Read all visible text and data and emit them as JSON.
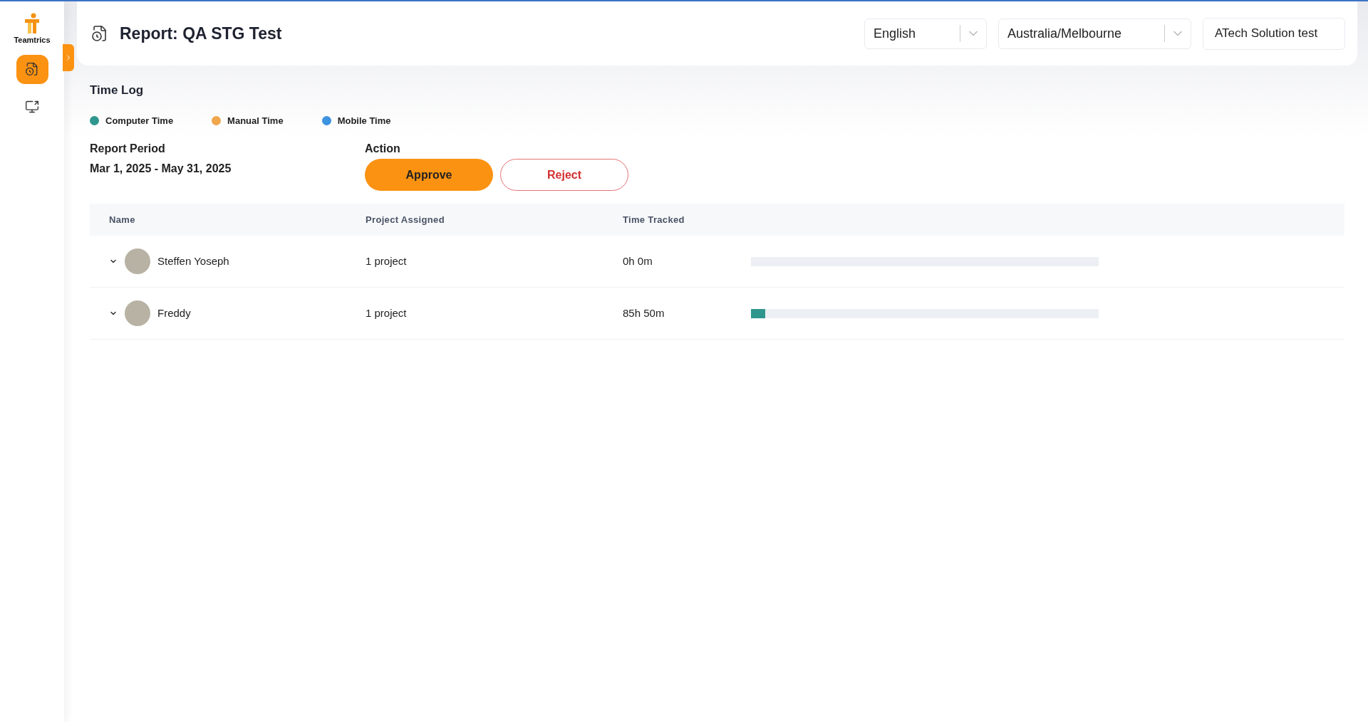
{
  "sidebar": {
    "logo_text": "Teamtrics",
    "items": [
      {
        "kind": "report",
        "selected": true
      },
      {
        "kind": "monitor",
        "selected": false
      }
    ]
  },
  "header": {
    "title": "Report: QA STG Test",
    "language": {
      "value": "English"
    },
    "timezone": {
      "value": "Australia/Melbourne"
    },
    "organization": {
      "value": "ATech Solution test"
    }
  },
  "section_title": "Time Log",
  "legend": [
    {
      "label": "Computer Time",
      "color": "#2f968d"
    },
    {
      "label": "Manual Time",
      "color": "#f0a64c"
    },
    {
      "label": "Mobile Time",
      "color": "#3d93e0"
    }
  ],
  "report_period": {
    "label": "Report Period",
    "value": "Mar 1, 2025 - May 31, 2025"
  },
  "action": {
    "label": "Action",
    "approve": "Approve",
    "reject": "Reject"
  },
  "table": {
    "columns": [
      "Name",
      "Project Assigned",
      "Time Tracked"
    ],
    "rows": [
      {
        "name": "Steffen Yoseph",
        "projects": "1 project",
        "time": "0h 0m",
        "level": 0
      },
      {
        "name": "Freddy",
        "projects": "1 project",
        "time": "85h 50m",
        "level": 0.04
      }
    ]
  }
}
